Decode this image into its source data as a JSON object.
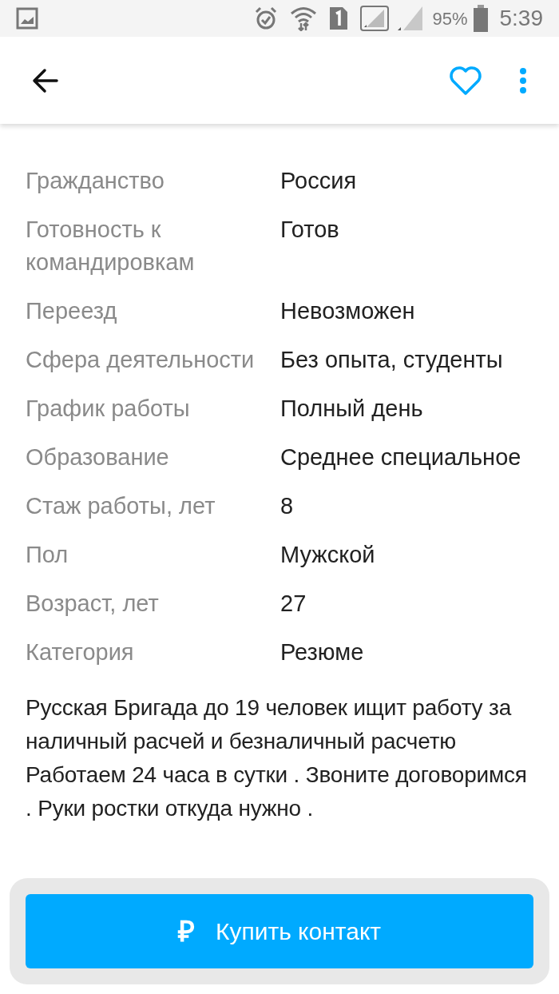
{
  "status_bar": {
    "battery": "95%",
    "time": "5:39"
  },
  "details": [
    {
      "label": "Гражданство",
      "value": "Россия"
    },
    {
      "label": "Готовность к командировкам",
      "value": "Готов"
    },
    {
      "label": "Переезд",
      "value": "Невозможен"
    },
    {
      "label": "Сфера деятельности",
      "value": "Без опыта, студенты"
    },
    {
      "label": "График работы",
      "value": "Полный день"
    },
    {
      "label": "Образование",
      "value": "Среднее специальное"
    },
    {
      "label": "Стаж работы, лет",
      "value": "8"
    },
    {
      "label": "Пол",
      "value": "Мужской"
    },
    {
      "label": "Возраст, лет",
      "value": "27"
    },
    {
      "label": "Категория",
      "value": "Резюме"
    }
  ],
  "description": "Русская Бригада до 19 человек ищит работу за наличный расчей и безналичный расчетю Работаем 24 часа в сутки . Звоните договоримся . Руки ростки откуда нужно .",
  "buy_button": {
    "icon": "₽",
    "label": "Купить контакт"
  }
}
